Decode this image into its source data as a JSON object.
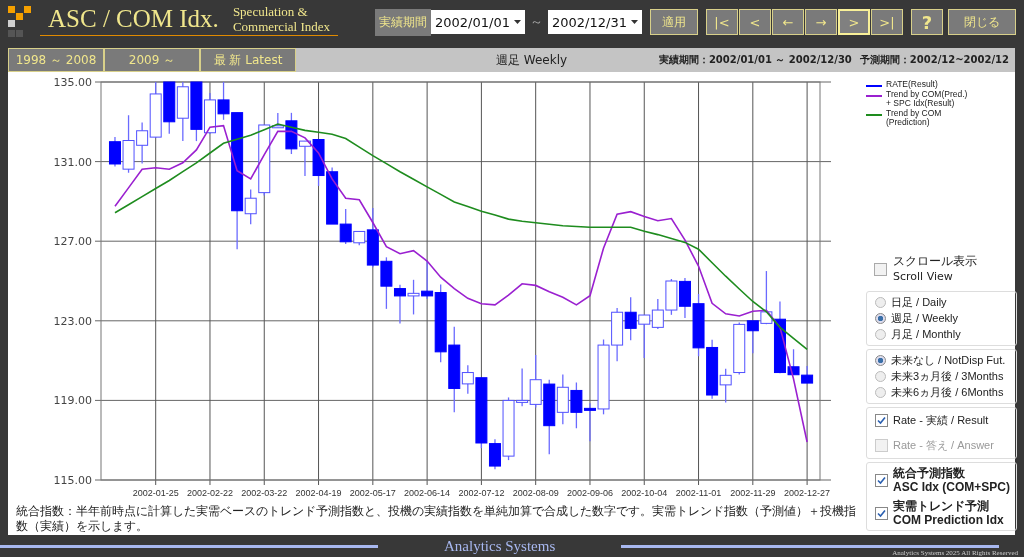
{
  "header": {
    "title": "ASC / COM Idx.",
    "subtitle": [
      "Speculation &",
      "Commercial Index"
    ],
    "period_label": "実績期間",
    "start_date": "2002/01/01",
    "separator": "～",
    "end_date": "2002/12/31",
    "apply_button": "適用",
    "nav_buttons": [
      {
        "label": "|<",
        "focused": false
      },
      {
        "label": "<",
        "focused": false
      },
      {
        "label": "←",
        "focused": false
      },
      {
        "label": "→",
        "focused": false
      },
      {
        "label": ">",
        "focused": true
      },
      {
        "label": ">|",
        "focused": false
      }
    ],
    "help_button": "?",
    "close_button": "閉じる"
  },
  "range_tabs": [
    {
      "label": "1998 ～ 2008",
      "selected": false
    },
    {
      "label": "2009 ～",
      "selected": false
    },
    {
      "label": "最 新  Latest",
      "selected": false
    }
  ],
  "info_bar": {
    "interval": "週足 Weekly",
    "result_period": "実績期間：2002/01/01 ～ 2002/12/30",
    "forecast_period": "予測期間：2002/12~2002/12"
  },
  "chart": {
    "rate_legend": {
      "label": "RATE(Result)",
      "color": "#0000ff"
    },
    "chart_data": {
      "type": "candlestick",
      "grid": true,
      "ylim": [
        115,
        135
      ],
      "categories": [
        null,
        null,
        null,
        "2002-01-25",
        null,
        null,
        null,
        "2002-02-22",
        null,
        null,
        null,
        "2002-03-22",
        null,
        null,
        null,
        "2002-04-19",
        null,
        null,
        null,
        "2002-05-17",
        null,
        null,
        null,
        "2002-06-14",
        null,
        null,
        null,
        "2002-07-12",
        null,
        null,
        null,
        "2002-08-09",
        null,
        null,
        null,
        "2002-09-06",
        null,
        null,
        null,
        "2002-10-04",
        null,
        null,
        null,
        "2002-11-01",
        null,
        null,
        null,
        "2002-11-29",
        null,
        null,
        null,
        "2002-12-27"
      ],
      "yticks": [
        {
          "value": 115,
          "label": "115.00"
        },
        {
          "value": 119,
          "label": "119.00"
        },
        {
          "value": 123,
          "label": "123.00"
        },
        {
          "value": 127,
          "label": "127.00"
        },
        {
          "value": 131,
          "label": "131.00"
        },
        {
          "value": 135,
          "label": "135.00"
        }
      ],
      "series": [
        {
          "name": "Trend by COM(Pred.) + SPC Idx(Result)",
          "type": "line",
          "color": "#9a20d0",
          "values": [
            128.76,
            129.68,
            130.62,
            130.69,
            130.62,
            130.94,
            131.59,
            132.73,
            132.81,
            130.54,
            130.13,
            131.35,
            132.52,
            132.53,
            132.19,
            131.43,
            130.13,
            129.16,
            129.08,
            127.94,
            126.73,
            126.37,
            126.53,
            126.0,
            125.19,
            124.62,
            124.13,
            123.86,
            123.8,
            124.29,
            124.86,
            124.78,
            124.46,
            124.18,
            123.8,
            124.26,
            126.65,
            128.35,
            128.48,
            128.24,
            128.03,
            128.14,
            127.05,
            125.75,
            123.88,
            123.35,
            123.24,
            123.48,
            123.53,
            122.67,
            120.08,
            116.91
          ]
        },
        {
          "name": "Trend by COM (Prediction)",
          "type": "line",
          "color": "#1e8c1e",
          "values": [
            128.43,
            128.83,
            129.24,
            129.65,
            130.05,
            130.5,
            130.94,
            131.43,
            131.92,
            132.12,
            132.32,
            132.6,
            132.89,
            132.73,
            132.57,
            132.47,
            132.37,
            132.16,
            131.73,
            131.3,
            130.9,
            130.49,
            130.11,
            129.73,
            129.35,
            128.97,
            128.74,
            128.51,
            128.31,
            128.11,
            128.0,
            127.93,
            127.85,
            127.78,
            127.74,
            127.7,
            127.7,
            127.7,
            127.7,
            127.5,
            127.33,
            127.14,
            126.94,
            126.6,
            125.92,
            125.24,
            124.6,
            123.97,
            123.45,
            122.67,
            122.12,
            121.57
          ]
        }
      ],
      "ohlc": [
        [
          132.0,
          132.24,
          130.76,
          130.88
        ],
        [
          130.62,
          133.33,
          130.44,
          132.06
        ],
        [
          131.82,
          132.97,
          130.91,
          132.55
        ],
        [
          132.23,
          135.0,
          132.2,
          134.4
        ],
        [
          135.0,
          135.0,
          132.4,
          133.0
        ],
        [
          133.18,
          135.0,
          132.03,
          134.76
        ],
        [
          135.0,
          135.0,
          132.03,
          132.62
        ],
        [
          132.45,
          134.45,
          132.4,
          134.1
        ],
        [
          134.1,
          135.0,
          133.1,
          133.4
        ],
        [
          133.46,
          133.46,
          126.6,
          128.53
        ],
        [
          128.38,
          129.6,
          127.85,
          129.16
        ],
        [
          129.44,
          132.84,
          129.3,
          132.84
        ],
        [
          132.71,
          133.44,
          132.7,
          132.8
        ],
        [
          133.05,
          133.45,
          131.38,
          131.64
        ],
        [
          131.77,
          132.03,
          130.28,
          132.03
        ],
        [
          132.11,
          132.11,
          129.78,
          130.3
        ],
        [
          130.49,
          130.7,
          127.86,
          127.86
        ],
        [
          127.86,
          128.62,
          126.86,
          126.97
        ],
        [
          126.92,
          127.49,
          126.8,
          127.49
        ],
        [
          127.57,
          128.67,
          125.69,
          125.8
        ],
        [
          125.99,
          126.19,
          123.6,
          124.74
        ],
        [
          124.62,
          124.81,
          122.87,
          124.25
        ],
        [
          124.25,
          125.06,
          123.32,
          124.38
        ],
        [
          124.49,
          126.0,
          124.1,
          124.25
        ],
        [
          124.42,
          124.83,
          120.92,
          121.44
        ],
        [
          121.78,
          122.7,
          118.4,
          119.6
        ],
        [
          119.83,
          120.77,
          119.33,
          120.4
        ],
        [
          120.14,
          120.14,
          116.6,
          116.86
        ],
        [
          116.83,
          117.05,
          115.54,
          115.7
        ],
        [
          116.2,
          119.15,
          116.0,
          119.0
        ],
        [
          118.9,
          120.6,
          118.7,
          119.0
        ],
        [
          118.8,
          121.28,
          118.64,
          120.04
        ],
        [
          119.82,
          120.04,
          116.3,
          117.73
        ],
        [
          118.4,
          120.3,
          117.8,
          119.66
        ],
        [
          119.5,
          119.9,
          117.6,
          118.4
        ],
        [
          118.6,
          118.86,
          116.95,
          118.5
        ],
        [
          118.57,
          122.06,
          118.3,
          121.78
        ],
        [
          121.78,
          123.64,
          120.97,
          123.43
        ],
        [
          123.43,
          124.18,
          122.02,
          122.62
        ],
        [
          122.83,
          123.29,
          121.13,
          123.29
        ],
        [
          122.67,
          124.09,
          122.59,
          123.54
        ],
        [
          123.54,
          125.1,
          123.3,
          125.0
        ],
        [
          124.98,
          125.15,
          123.14,
          123.73
        ],
        [
          123.86,
          124.35,
          121.22,
          121.64
        ],
        [
          121.66,
          122.05,
          119.08,
          119.27
        ],
        [
          119.78,
          120.59,
          118.89,
          120.26
        ],
        [
          120.4,
          122.92,
          120.3,
          122.82
        ],
        [
          123.0,
          123.0,
          121.37,
          122.5
        ],
        [
          122.87,
          125.5,
          122.83,
          123.45
        ],
        [
          123.08,
          123.97,
          120.37,
          120.4
        ],
        [
          120.69,
          121.57,
          120.29,
          120.29
        ],
        [
          120.27,
          120.73,
          119.87,
          119.87
        ]
      ]
    },
    "caption": "統合指数：半年前時点に計算した実需ベースのトレンド予測指数と、投機の実績指数を単純加算で合成した数字です。実需トレンド指数（予測値）＋投機指数（実績）を示します。"
  },
  "options": {
    "scroll_view": {
      "label_ja": "スクロール表示",
      "label_en": "Scroll View",
      "checked": false
    },
    "interval_options": [
      {
        "label": "日足 / Daily",
        "selected": false
      },
      {
        "label": "週足 / Weekly",
        "selected": true
      },
      {
        "label": "月足 / Monthly",
        "selected": false
      }
    ],
    "future_options": [
      {
        "label": "未来なし / NotDisp Fut.",
        "selected": true
      },
      {
        "label": "未来3ヵ月後 / 3Months",
        "selected": false
      },
      {
        "label": "未来6ヵ月後 / 6Months",
        "selected": false
      }
    ],
    "rate_options": [
      {
        "label": "Rate - 実績 / Result",
        "checked": true,
        "disabled": false
      },
      {
        "label": "Rate - 答え / Answer",
        "checked": false,
        "disabled": true
      }
    ],
    "index_options": [
      {
        "label_ja": "統合予測指数",
        "label_en": "ASC Idx (COM+SPC)",
        "checked": true
      },
      {
        "label_ja": "実需トレンド予測",
        "label_en": "COM Prediction Idx",
        "checked": true
      }
    ]
  },
  "footer": {
    "brand": "Analytics Systems",
    "copyright": "Analytics Systems 2025 All Rights Reserved"
  }
}
